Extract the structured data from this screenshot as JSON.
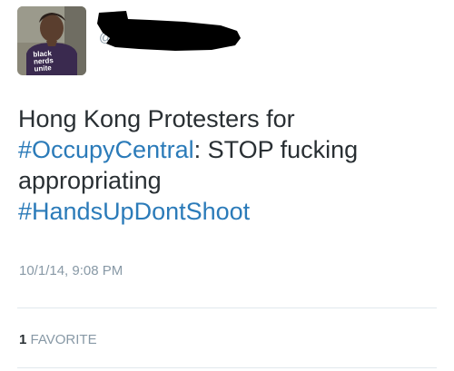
{
  "user": {
    "avatar_shirt_lines": [
      "black",
      "nerds",
      "unite"
    ],
    "handle_prefix": "@"
  },
  "tweet": {
    "line1": "Hong Kong Protesters for",
    "line2_hashtag": "#OccupyCentral",
    "line2_rest": ": STOP fucking",
    "line3": "appropriating",
    "line4_hashtag": "#HandsUpDontShoot",
    "timestamp": "10/1/14, 9:08 PM"
  },
  "stats": {
    "favorite_count": "1",
    "favorite_label": "FAVORITE"
  },
  "colors": {
    "hashtag": "#2b7bb9",
    "meta_gray": "#8899a6",
    "text": "#292f33",
    "divider": "#e1e8ed",
    "redaction": "#000000"
  }
}
